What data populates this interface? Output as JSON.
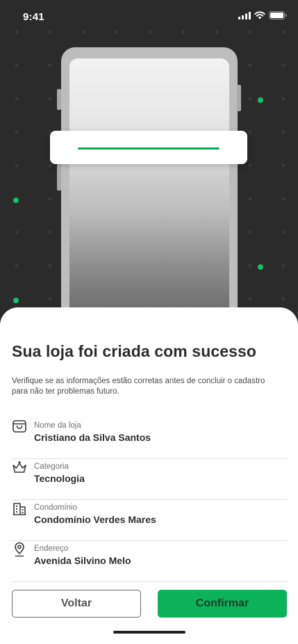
{
  "status_bar": {
    "time": "9:41"
  },
  "title": "Sua loja foi criada com sucesso",
  "description": "Verifique se as informações estão corretas antes de concluir o cadastro para não ter problemas futuro.",
  "details": [
    {
      "icon": "shopping-bag-icon",
      "label": "Nome da loja",
      "value": "Cristiano da Silva Santos"
    },
    {
      "icon": "crown-icon",
      "label": "Categoria",
      "value": "Tecnologia"
    },
    {
      "icon": "building-icon",
      "label": "Condomínio",
      "value": "Condomínio Verdes Mares"
    },
    {
      "icon": "location-pin-icon",
      "label": "Endereço",
      "value": "Avenida Silvino Melo"
    }
  ],
  "buttons": {
    "back": "Voltar",
    "confirm": "Confirmar"
  },
  "colors": {
    "accent": "#0DB35B",
    "hero_background": "#2B2B2B",
    "text_primary": "#2D2D2D"
  }
}
